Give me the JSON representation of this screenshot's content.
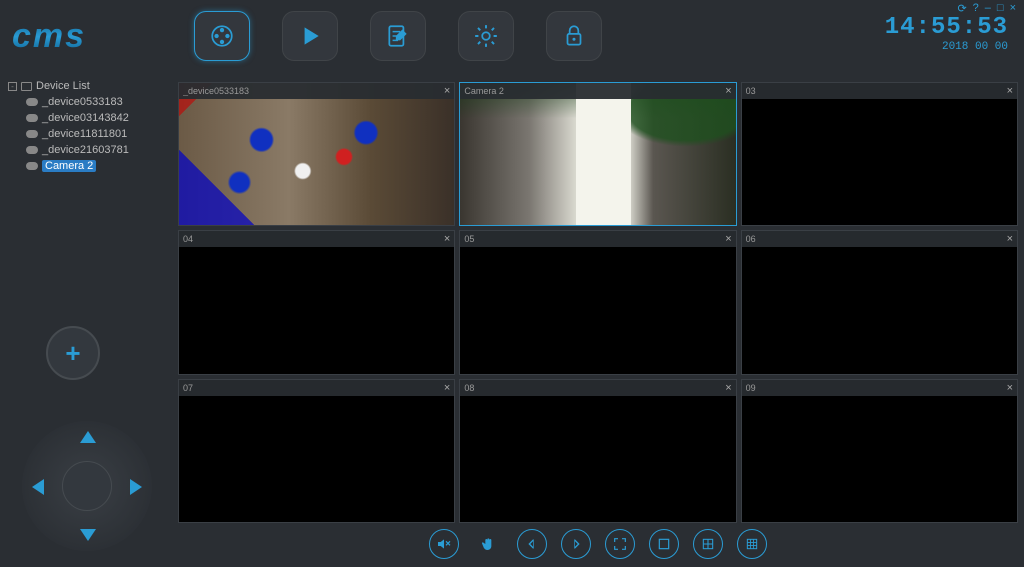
{
  "app": {
    "logo": "cms"
  },
  "clock": {
    "time": "14:55:53",
    "date": "2018 00 00"
  },
  "win": {
    "refresh": "⟳",
    "help": "?",
    "min": "–",
    "max": "□",
    "close": "×"
  },
  "sidebar": {
    "root": "Device List",
    "items": [
      {
        "label": "_device0533183"
      },
      {
        "label": "_device03143842"
      },
      {
        "label": "_device11811801"
      },
      {
        "label": "_device21603781"
      },
      {
        "label": "Camera 2",
        "selected": true
      }
    ]
  },
  "grid": [
    {
      "title": "_device0533183",
      "feed": 1,
      "selected": false
    },
    {
      "title": "Camera 2",
      "feed": 2,
      "selected": true
    },
    {
      "title": "03",
      "feed": 0,
      "selected": false
    },
    {
      "title": "04",
      "feed": 0,
      "selected": false
    },
    {
      "title": "05",
      "feed": 0,
      "selected": false
    },
    {
      "title": "06",
      "feed": 0,
      "selected": false
    },
    {
      "title": "07",
      "feed": 0,
      "selected": false
    },
    {
      "title": "08",
      "feed": 0,
      "selected": false
    },
    {
      "title": "09",
      "feed": 0,
      "selected": false
    }
  ],
  "close_glyph": "×",
  "plus_glyph": "+"
}
